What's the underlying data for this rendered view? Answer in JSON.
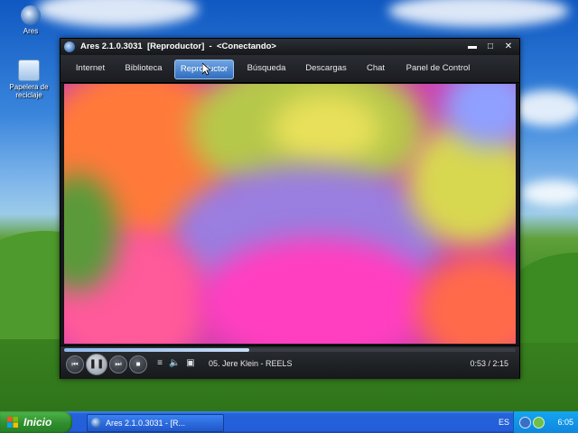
{
  "desktop": {
    "icons": [
      {
        "label": "Ares",
        "icon": "ares-shortcut-icon"
      },
      {
        "label": "Papelera de reciclaje",
        "icon": "recycle-bin-icon"
      }
    ]
  },
  "window": {
    "title": "Ares 2.1.0.3031  [Reproductor]  -  <Conectando>",
    "controls": {
      "minimize": "▬",
      "maximize": "□",
      "close": "✕"
    },
    "tabs": [
      {
        "label": "Internet",
        "active": false
      },
      {
        "label": "Biblioteca",
        "active": false
      },
      {
        "label": "Reproductor",
        "active": true
      },
      {
        "label": "Búsqueda",
        "active": false
      },
      {
        "label": "Descargas",
        "active": false
      },
      {
        "label": "Chat",
        "active": false
      },
      {
        "label": "Panel de Control",
        "active": false
      }
    ]
  },
  "player": {
    "progress_fraction": 0.41,
    "track": "05. Jere Klein - REELS",
    "time": "0:53 / 2:15",
    "buttons": {
      "prev": "⏮",
      "pause": "❚❚",
      "next": "⏭",
      "stop": "■",
      "playlist": "≡",
      "volume": "🔈",
      "fullscreen": "▣"
    }
  },
  "taskbar": {
    "start_label": "Inicio",
    "task_label": "Ares 2.1.0.3031 - [R...",
    "language": "ES",
    "clock": "6:05"
  },
  "colors": {
    "accent": "#2f6dc0",
    "window_bg": "#141619",
    "taskbar": "#245edb",
    "start_green": "#2f8f2e"
  }
}
